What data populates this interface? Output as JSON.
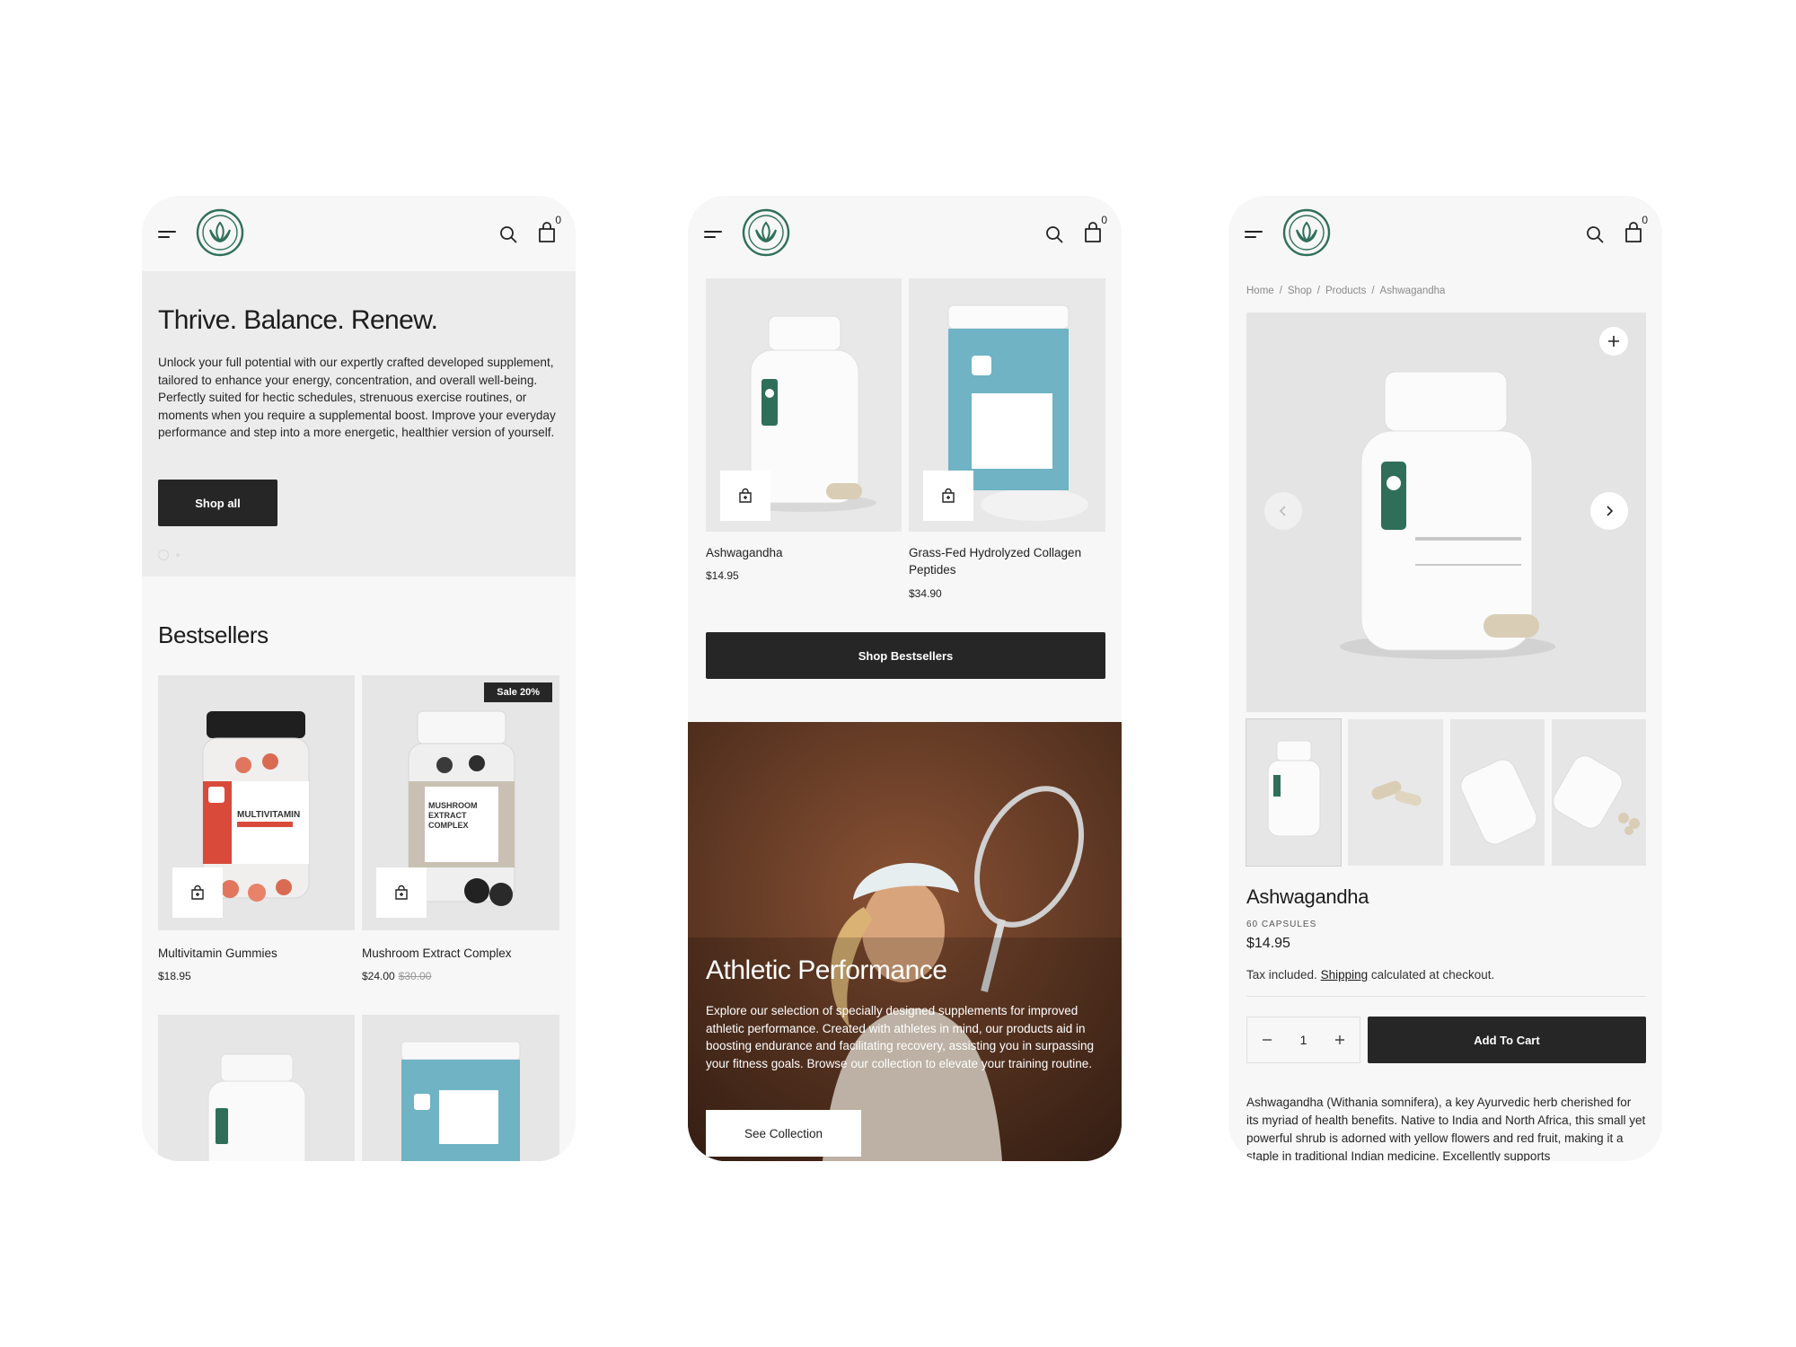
{
  "colors": {
    "accent": "#2f6f59",
    "dark_button": "#262626",
    "badge": "#262626"
  },
  "header": {
    "cart_count": "0",
    "icons": [
      "hamburger-icon",
      "logo",
      "search-icon",
      "cart-icon"
    ]
  },
  "screen1": {
    "hero": {
      "title": "Thrive. Balance. Renew.",
      "text": "Unlock your full potential with our expertly crafted developed supplement, tailored to enhance your energy, concentration, and overall well-being. Perfectly suited for hectic schedules, strenuous exercise routines, or moments when you require a supplemental boost. Improve your everyday performance and step into a more energetic, healthier version of yourself.",
      "button": "Shop all"
    },
    "bestsellers_title": "Bestsellers",
    "products": [
      {
        "name": "Multivitamin Gummies",
        "price": "$18.95"
      },
      {
        "name": "Mushroom Extract Complex",
        "price": "$24.00",
        "old_price": "$30.00",
        "badge": "Sale 20%"
      }
    ]
  },
  "screen2": {
    "products": [
      {
        "name": "Ashwagandha",
        "price": "$14.95"
      },
      {
        "name": "Grass-Fed Hydrolyzed Collagen Peptides",
        "price": "$34.90"
      }
    ],
    "shop_button": "Shop Bestsellers",
    "banner": {
      "title": "Athletic Performance",
      "text": "Explore our selection of specially designed supplements for improved athletic performance. Created with athletes in mind, our products aid in boosting endurance and facilitating recovery, assisting you in surpassing your fitness goals. Browse our collection to elevate your training routine.",
      "button": "See Collection"
    }
  },
  "screen3": {
    "breadcrumb": [
      "Home",
      "Shop",
      "Products",
      "Ashwagandha"
    ],
    "title": "Ashwagandha",
    "subtitle": "60 CAPSULES",
    "price": "$14.95",
    "tax_prefix": "Tax included.",
    "tax_link": "Shipping",
    "tax_suffix": "calculated at checkout.",
    "quantity": "1",
    "add_to_cart": "Add To Cart",
    "description": "Ashwagandha (Withania somnifera), a key Ayurvedic herb cherished for its myriad of health benefits. Native to India and North Africa, this small yet powerful shrub is adorned with yellow flowers and red fruit, making it a staple in traditional Indian medicine. Excellently supports"
  }
}
